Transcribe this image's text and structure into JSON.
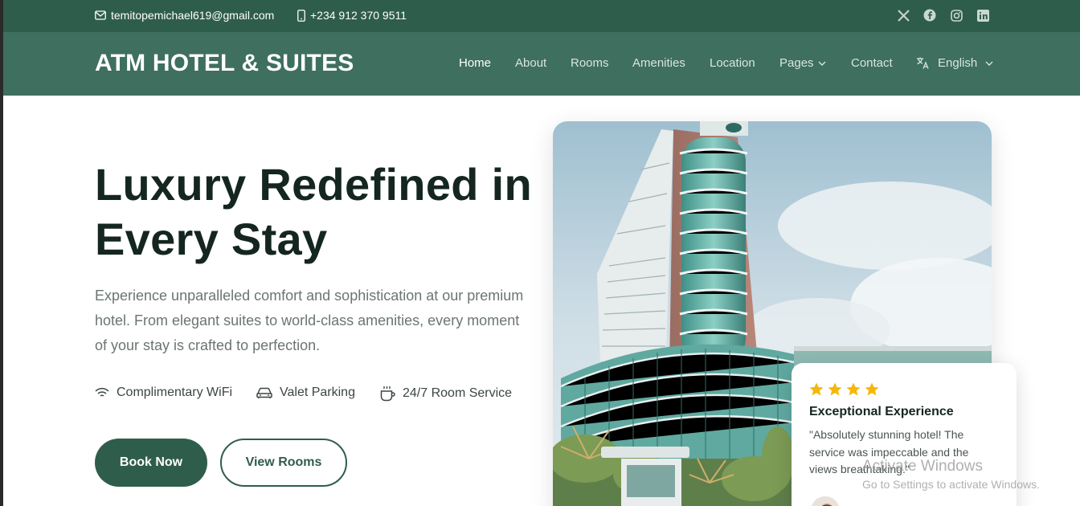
{
  "topbar": {
    "email": "temitopemichael619@gmail.com",
    "phone": "+234 912 370 9511",
    "socials": [
      "x-icon",
      "facebook-icon",
      "instagram-icon",
      "linkedin-icon"
    ]
  },
  "nav": {
    "logo": "ATM HOTEL & SUITES",
    "items": [
      {
        "label": "Home",
        "active": true
      },
      {
        "label": "About"
      },
      {
        "label": "Rooms"
      },
      {
        "label": "Amenities"
      },
      {
        "label": "Location"
      },
      {
        "label": "Pages"
      },
      {
        "label": "Contact"
      }
    ],
    "language": "English"
  },
  "hero": {
    "title_line1": "Luxury Redefined in",
    "title_line2": "Every Stay",
    "description": "Experience unparalleled comfort and sophistication at our premium hotel. From elegant suites to world-class amenities, every moment of your stay is crafted to perfection.",
    "features": [
      {
        "icon": "wifi-icon",
        "label": "Complimentary WiFi"
      },
      {
        "icon": "car-icon",
        "label": "Valet Parking"
      },
      {
        "icon": "coffee-icon",
        "label": "24/7 Room Service"
      }
    ],
    "book_button": "Book Now",
    "rooms_button": "View Rooms"
  },
  "review": {
    "stars": 4,
    "title": "Exceptional Experience",
    "text": "\"Absolutely stunning hotel! The service was impeccable and the views breathtaking.\""
  },
  "watermark": {
    "line1": "Activate Windows",
    "line2": "Go to Settings to activate Windows."
  },
  "colors": {
    "primary": "#2f5d4c",
    "nav_bg": "#3f6f5e",
    "star": "#f5b80a"
  }
}
